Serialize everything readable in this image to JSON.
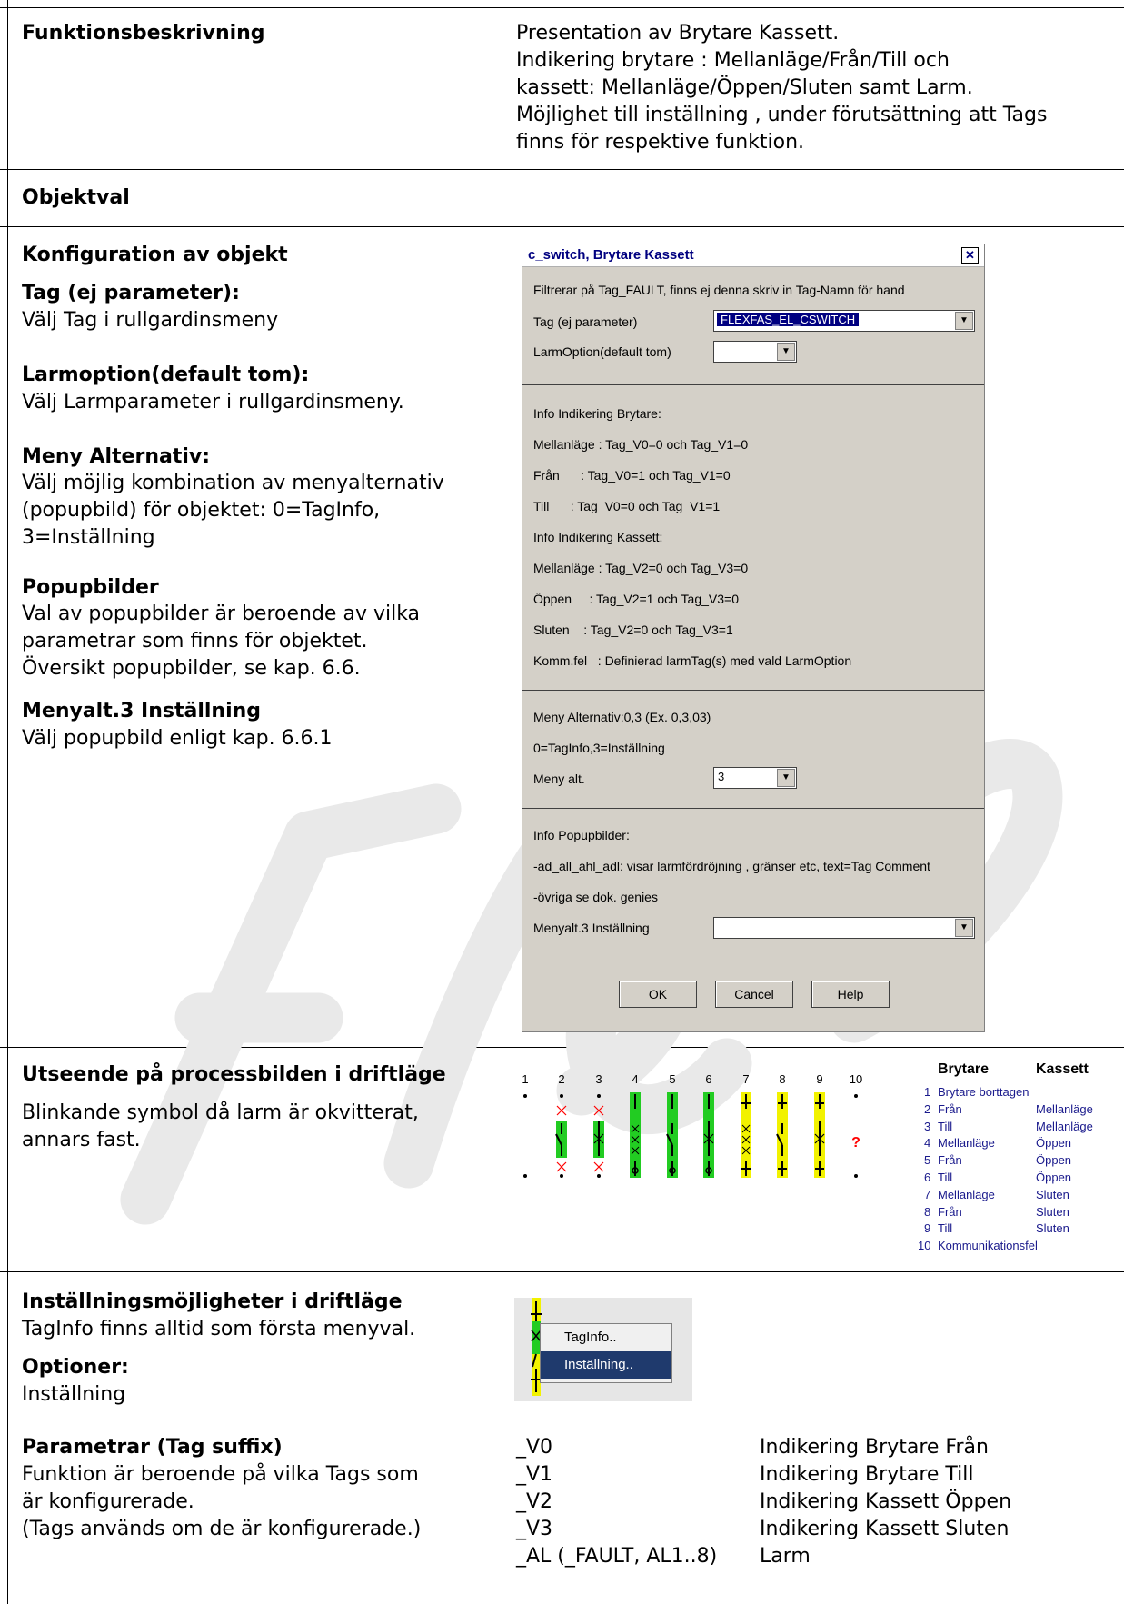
{
  "rows": {
    "funktion": {
      "label": "Funktionsbeskrivning",
      "text": "Presentation av Brytare Kassett.\nIndikering brytare : Mellanläge/Från/Till och\nkassett: Mellanläge/Öppen/Sluten samt Larm.\nMöjlighet till inställning , under förutsättning att Tags\nfinns för respektive funktion."
    },
    "objektval": {
      "label": "Objektval"
    },
    "konfig": {
      "label": "Konfiguration av objekt",
      "tag_h": "Tag (ej parameter):",
      "tag_t": "Välj Tag i rullgardinsmeny",
      "larm_h": "Larmoption(default tom):",
      "larm_t": "Välj  Larmparameter i rullgardinsmeny.",
      "meny_h": "Meny Alternativ:",
      "meny_t": "Välj möjlig kombination av menyalternativ\n(popupbild) för objektet: 0=TagInfo,\n3=Inställning",
      "popup_h": "Popupbilder",
      "popup_t": "Val av popupbilder är beroende av vilka\nparametrar som finns för objektet.\nÖversikt popupbilder, se kap. 6.6.",
      "menyalt_h": "Menyalt.3 Inställning",
      "menyalt_t": "Välj popupbild enligt kap. 6.6.1"
    },
    "utseende": {
      "label": "Utseende på processbilden i driftläge",
      "text": "Blinkande symbol då larm är okvitterat,\nannars fast."
    },
    "installning": {
      "label": "Inställningsmöjligheter i driftläge",
      "text": "TagInfo finns alltid som första menyval.",
      "opt_h": "Optioner:",
      "opt_t": "Inställning"
    },
    "parametrar": {
      "label": "Parametrar (Tag suffix)",
      "text": "Funktion är beroende på vilka Tags  som\när konfigurerade.\n(Tags används om de är konfigurerade.)",
      "items": [
        {
          "suffix": "_V0",
          "desc": "Indikering Brytare Från"
        },
        {
          "suffix": "_V1",
          "desc": "Indikering Brytare Till"
        },
        {
          "suffix": "_V2",
          "desc": "Indikering Kassett Öppen"
        },
        {
          "suffix": "_V3",
          "desc": "Indikering Kassett Sluten"
        },
        {
          "suffix": "_AL (_FAULT, AL1..8)",
          "desc": "Larm"
        }
      ]
    }
  },
  "dialog": {
    "title": "c_switch, Brytare Kassett",
    "filter_text": "Filtrerar på Tag_FAULT, finns ej denna skriv in Tag-Namn för hand",
    "tag_label": "Tag (ej parameter)",
    "tag_value": "FLEXFAS_EL_CSWITCH",
    "larmopt_label": "LarmOption(default tom)",
    "larmopt_value": "",
    "info_brytare": "Info Indikering Brytare:",
    "b_mellan": "Mellanläge : Tag_V0=0 och Tag_V1=0",
    "b_fran": "Från      : Tag_V0=1 och Tag_V1=0",
    "b_till": "Till      : Tag_V0=0 och Tag_V1=1",
    "info_kassett": "Info Indikering Kassett:",
    "k_mellan": "Mellanläge : Tag_V2=0 och Tag_V3=0",
    "k_oppen": "Öppen     : Tag_V2=1 och Tag_V3=0",
    "k_sluten": "Sluten    : Tag_V2=0 och Tag_V3=1",
    "kommfel": "Komm.fel   : Definierad larmTag(s) med vald LarmOption",
    "meny_alt_text": "Meny Alternativ:0,3 (Ex. 0,3,03)",
    "meny_def": "0=TagInfo,3=Inställning",
    "meny_label": "Meny alt.",
    "meny_value": "3",
    "info_popup": "Info Popupbilder:",
    "popup1": "-ad_all_ahl_adl: visar larmfördröjning , gränser etc, text=Tag Comment",
    "popup2": "-övriga se dok. genies",
    "menyalt3_label": "Menyalt.3 Inställning",
    "menyalt3_value": "",
    "ok": "OK",
    "cancel": "Cancel",
    "help": "Help"
  },
  "symbols": {
    "numbers": [
      "1",
      "2",
      "3",
      "4",
      "5",
      "6",
      "7",
      "8",
      "9",
      "10"
    ],
    "alarm_mark": "?",
    "colors": {
      "green": "#22cc22",
      "yellow": "#f2f200",
      "red": "#ff0000"
    }
  },
  "legend": {
    "header_brytare": "Brytare",
    "header_kassett": "Kassett",
    "rows": [
      {
        "n": "1",
        "brytare": "Brytare borttagen",
        "kassett": ""
      },
      {
        "n": "2",
        "brytare": "Från",
        "kassett": "Mellanläge"
      },
      {
        "n": "3",
        "brytare": "Till",
        "kassett": "Mellanläge"
      },
      {
        "n": "4",
        "brytare": "Mellanläge",
        "kassett": "Öppen"
      },
      {
        "n": "5",
        "brytare": "Från",
        "kassett": "Öppen"
      },
      {
        "n": "6",
        "brytare": "Till",
        "kassett": "Öppen"
      },
      {
        "n": "7",
        "brytare": "Mellanläge",
        "kassett": "Sluten"
      },
      {
        "n": "8",
        "brytare": "Från",
        "kassett": "Sluten"
      },
      {
        "n": "9",
        "brytare": "Till",
        "kassett": "Sluten"
      },
      {
        "n": "10",
        "brytare": "Kommunikationsfel",
        "kassett": ""
      }
    ]
  },
  "context_menu": {
    "item1": "TagInfo..",
    "item2": "Inställning.."
  }
}
